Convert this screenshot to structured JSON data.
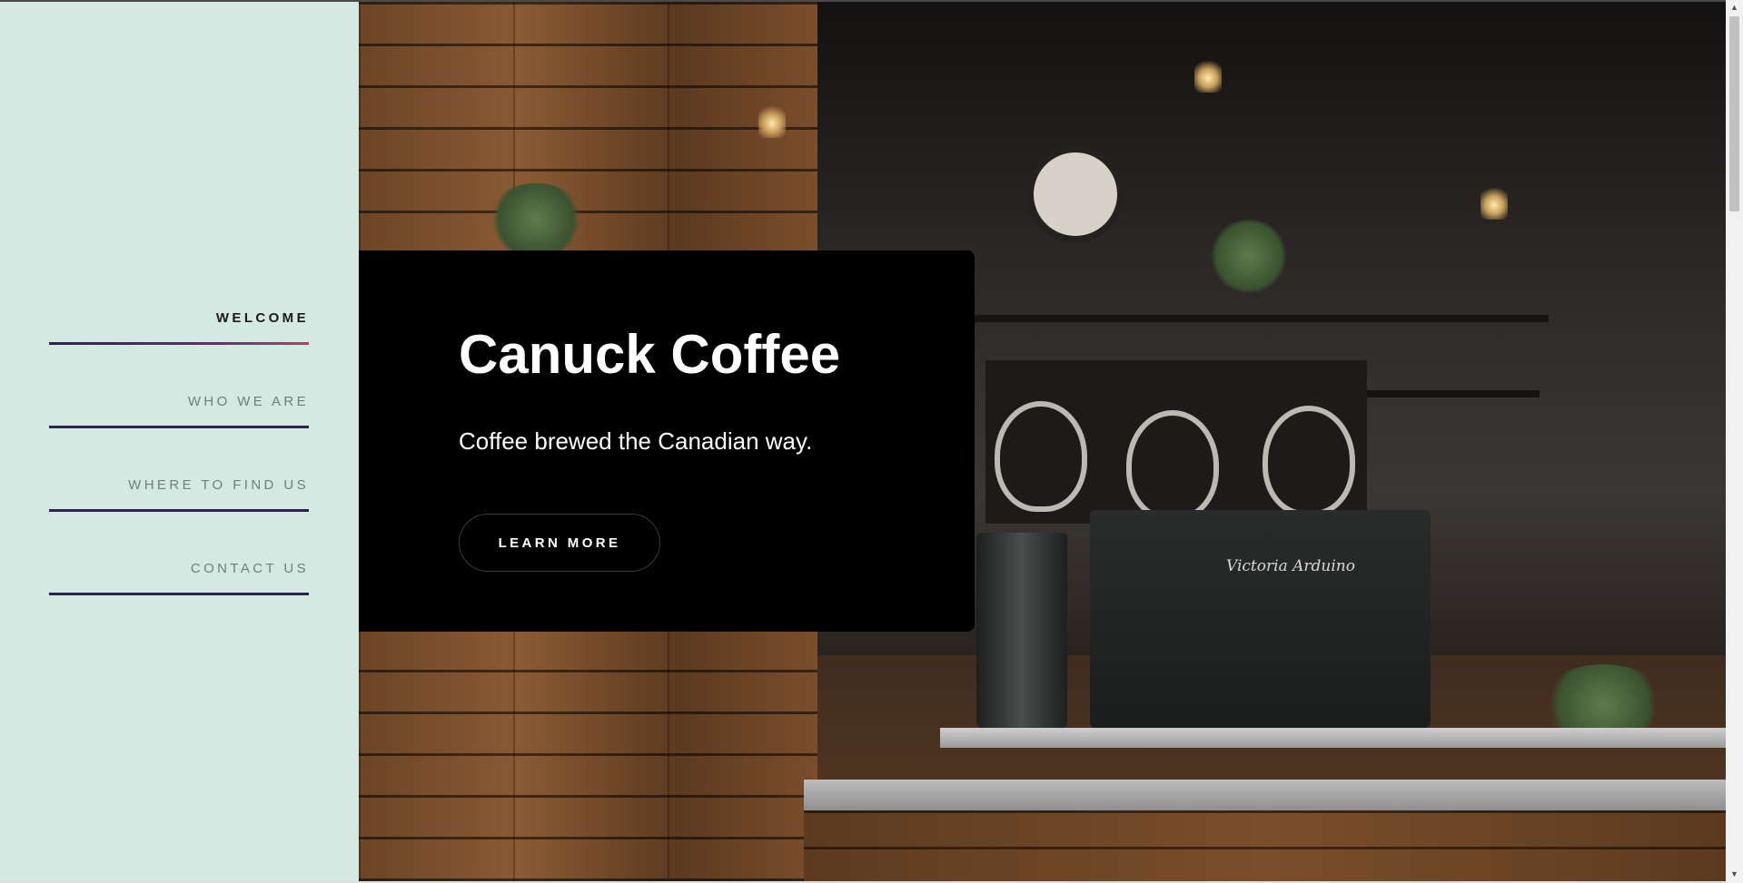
{
  "nav": {
    "items": [
      {
        "label": "WELCOME",
        "active": true
      },
      {
        "label": "WHO WE ARE",
        "active": false
      },
      {
        "label": "WHERE TO FIND US",
        "active": false
      },
      {
        "label": "CONTACT US",
        "active": false
      }
    ]
  },
  "hero": {
    "title": "Canuck Coffee",
    "subtitle": "Coffee brewed the Canadian way.",
    "cta_label": "LEARN MORE",
    "background": "cafe-interior-photo",
    "machine_brand": "Victoria Arduino"
  },
  "colors": {
    "sidebar_bg": "#d5e9e3",
    "nav_underline": "#2c2353",
    "nav_active_accent": "#c23b66",
    "card_bg": "#000000",
    "text_white": "#ffffff"
  },
  "scrollbar": {
    "up_icon": "triangle-up-icon",
    "down_icon": "triangle-down-icon"
  }
}
